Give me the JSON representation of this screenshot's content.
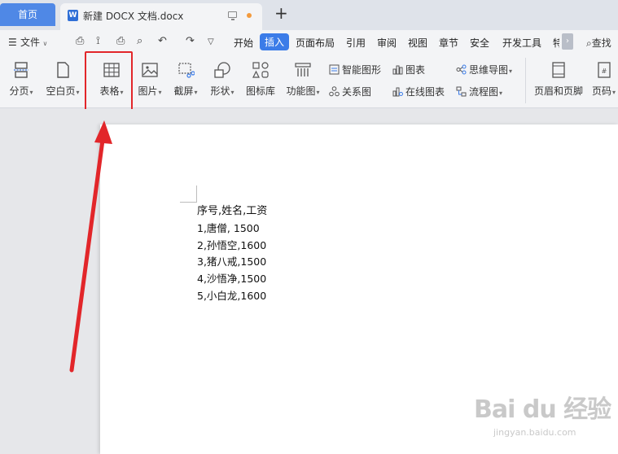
{
  "tabs": {
    "home": "首页",
    "doc_title": "新建 DOCX 文档.docx",
    "new_tab": "+"
  },
  "menu": {
    "file": "文件",
    "tabs": [
      "开始",
      "插入",
      "页面布局",
      "引用",
      "审阅",
      "视图",
      "章节",
      "安全",
      "开发工具",
      "特"
    ],
    "active_tab": "插入",
    "search": "查找"
  },
  "ribbon": {
    "page_break": "分页",
    "blank_page": "空白页",
    "table": "表格",
    "picture": "图片",
    "screenshot": "截屏",
    "shapes": "形状",
    "icon_library": "图标库",
    "function_chart": "功能图",
    "smart_graphic": "智能图形",
    "chart": "图表",
    "mind_map": "思维导图",
    "relation_chart": "关系图",
    "online_chart": "在线图表",
    "flowchart": "流程图",
    "header_footer": "页眉和页脚",
    "page_number": "页码"
  },
  "document": {
    "lines": [
      "序号,姓名,工资",
      "1,唐僧, 1500",
      "2,孙悟空,1600",
      "3,猪八戒,1500",
      "4,沙悟净,1500",
      "5,小白龙,1600"
    ]
  },
  "watermark": {
    "logo": "Bai du 经验",
    "url": "jingyan.baidu.com"
  },
  "colors": {
    "accent": "#3b7ce8",
    "highlight": "#e2262a",
    "home_tab": "#4f88e6"
  }
}
